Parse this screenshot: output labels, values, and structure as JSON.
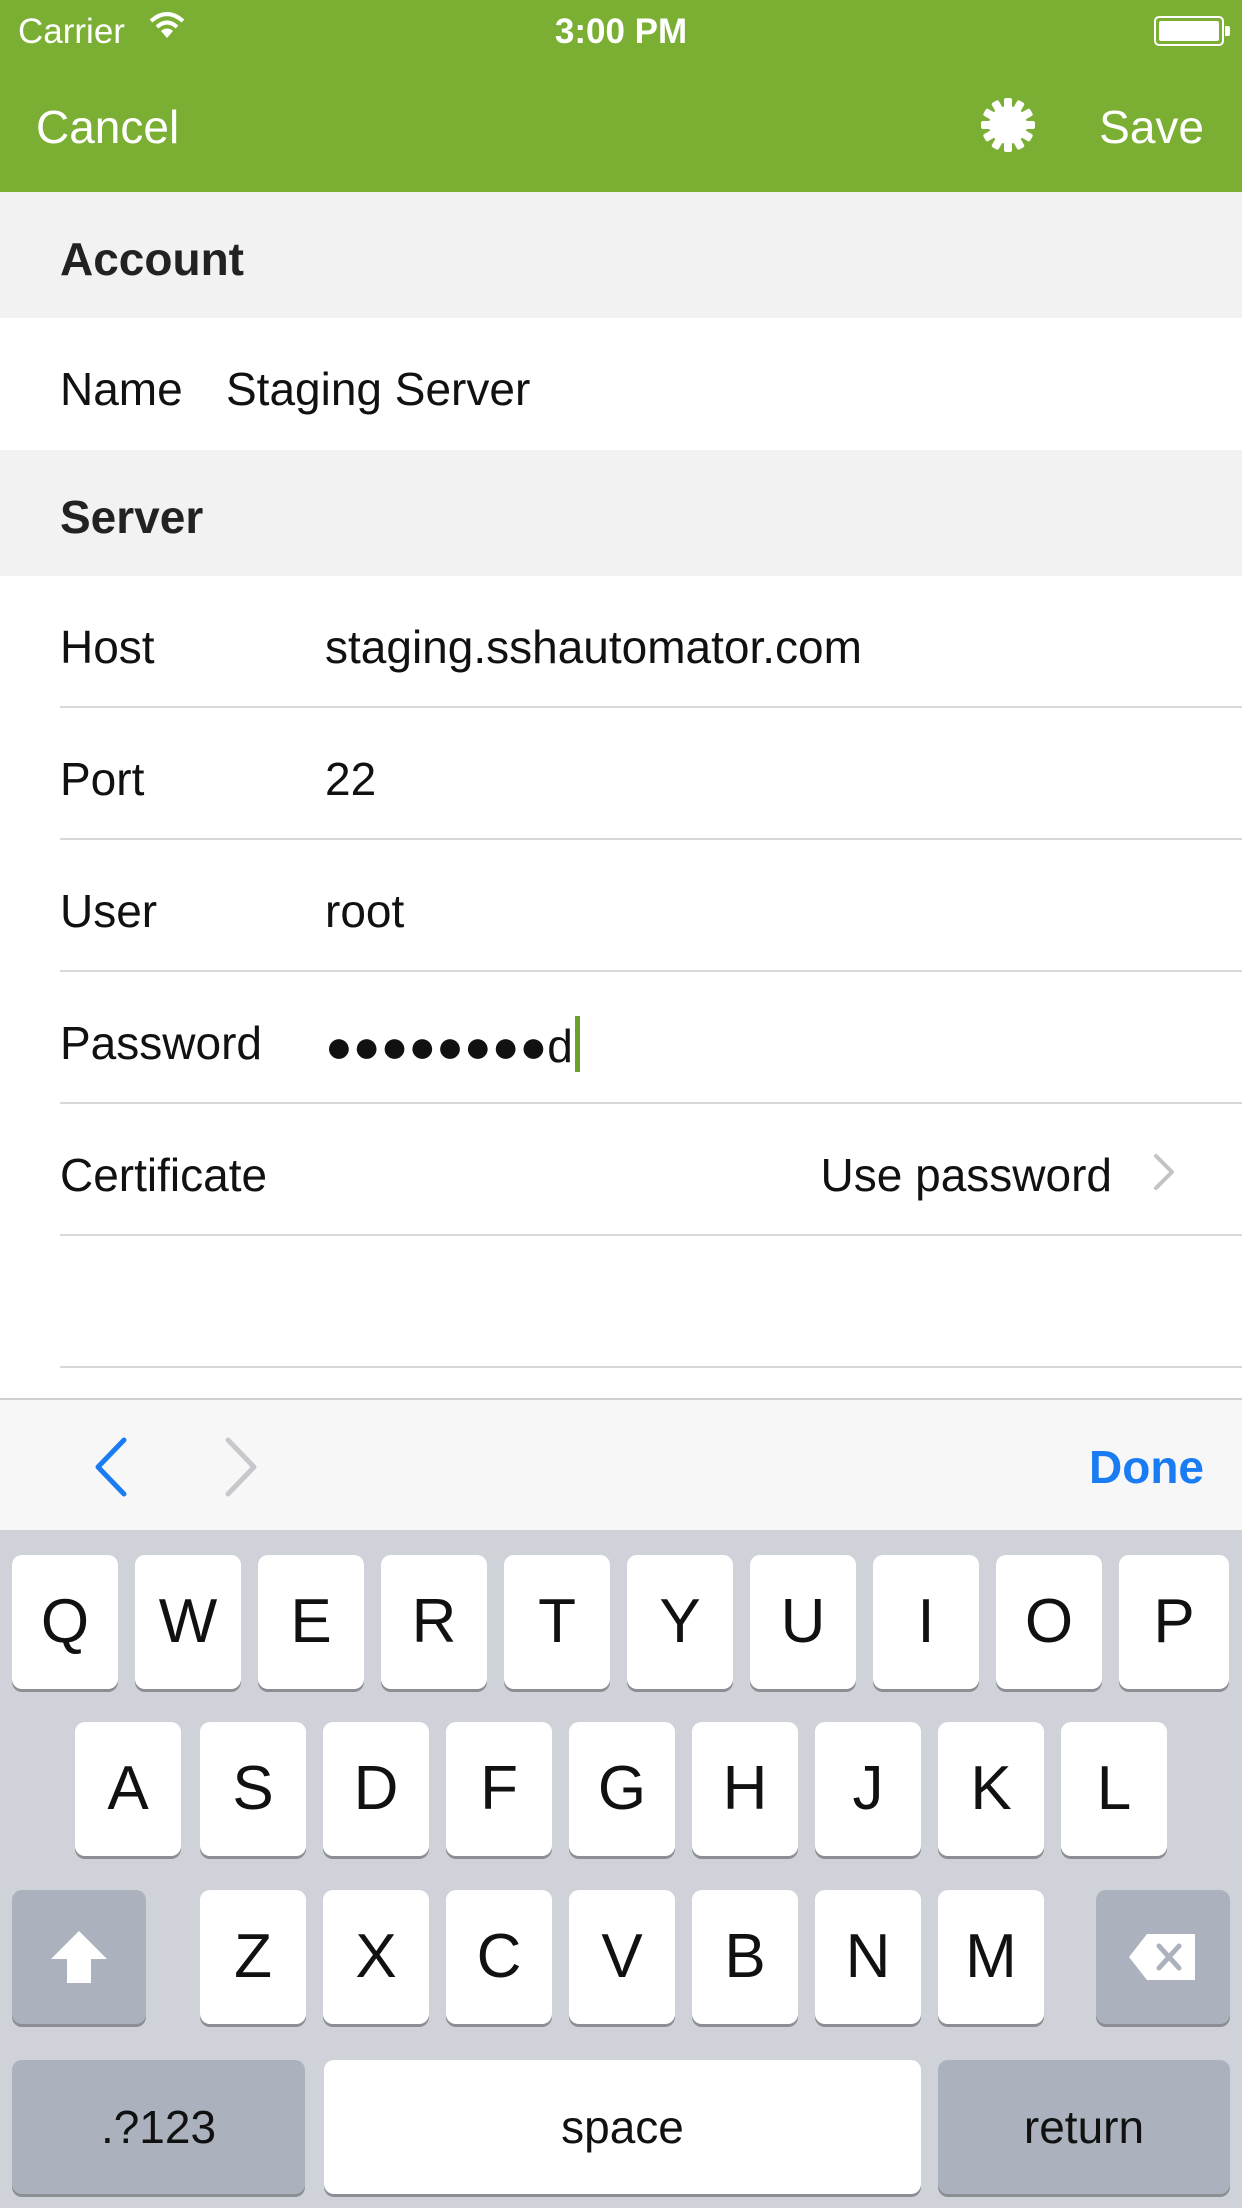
{
  "status_bar": {
    "carrier": "Carrier",
    "time": "3:00 PM"
  },
  "nav": {
    "cancel_label": "Cancel",
    "save_label": "Save"
  },
  "account_section": {
    "title": "Account",
    "name_label": "Name",
    "name_value": "Staging Server"
  },
  "server_section": {
    "title": "Server",
    "rows": [
      {
        "label": "Host",
        "value": "staging.sshautomator.com"
      },
      {
        "label": "Port",
        "value": "22"
      },
      {
        "label": "User",
        "value": "root"
      },
      {
        "label": "Password",
        "value": "●●●●●●●●d"
      }
    ],
    "certificate_label": "Certificate",
    "certificate_value": "Use password"
  },
  "toolbar": {
    "done_label": "Done"
  },
  "keyboard": {
    "row1": [
      "Q",
      "W",
      "E",
      "R",
      "T",
      "Y",
      "U",
      "I",
      "O",
      "P"
    ],
    "row2": [
      "A",
      "S",
      "D",
      "F",
      "G",
      "H",
      "J",
      "K",
      "L"
    ],
    "row3": [
      "Z",
      "X",
      "C",
      "V",
      "B",
      "N",
      "M"
    ],
    "numbers_label": ".?123",
    "space_label": "space",
    "return_label": "return"
  },
  "colors": {
    "nav_background": "#7aaf33",
    "done_blue": "#1a7cf2",
    "keyboard_background": "#cfd3d9"
  }
}
